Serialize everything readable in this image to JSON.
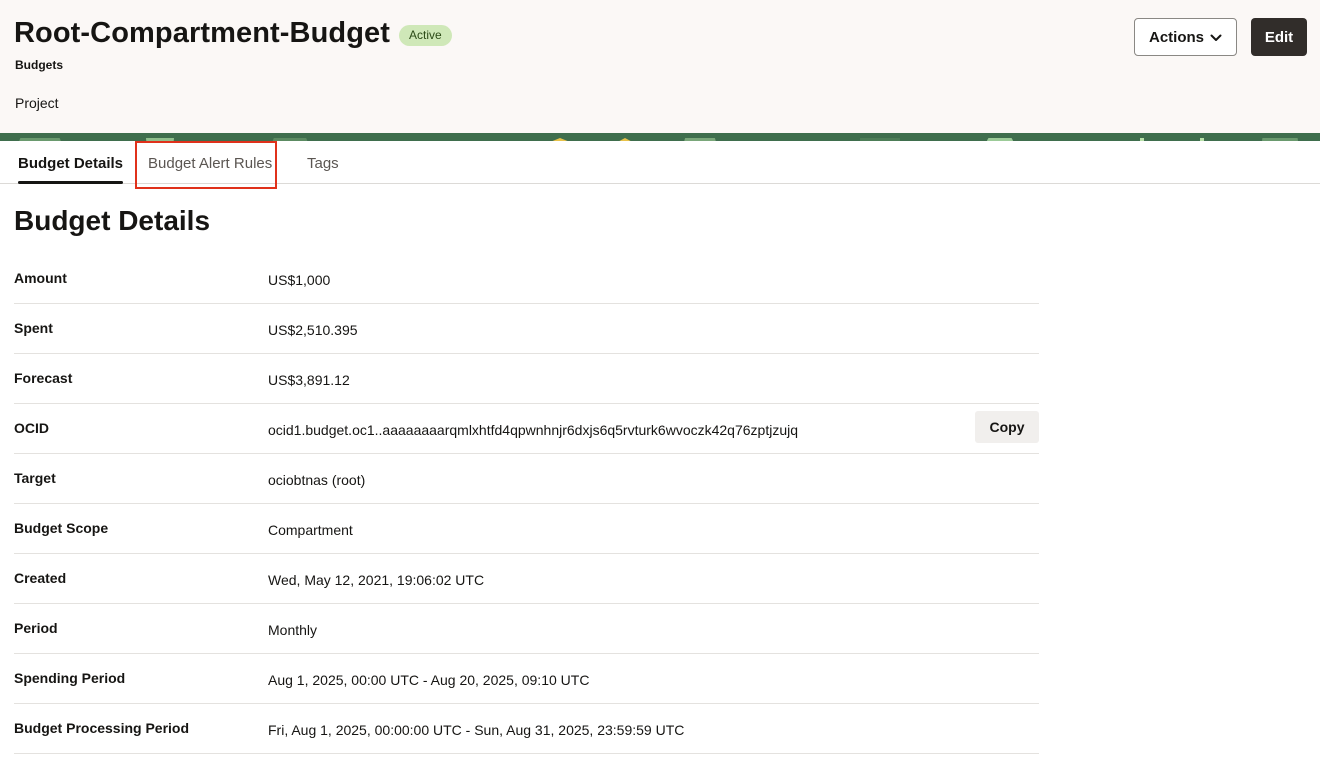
{
  "header": {
    "title": "Root-Compartment-Budget",
    "status_badge": "Active",
    "breadcrumb": "Budgets",
    "project_label": "Project",
    "actions_label": "Actions",
    "edit_label": "Edit"
  },
  "tabs": [
    {
      "label": "Budget Details",
      "active": true
    },
    {
      "label": "Budget Alert Rules",
      "active": false
    },
    {
      "label": "Tags",
      "active": false
    }
  ],
  "section": {
    "title": "Budget Details"
  },
  "details": [
    {
      "label": "Amount",
      "value": "US$1,000"
    },
    {
      "label": "Spent",
      "value": "US$2,510.395"
    },
    {
      "label": "Forecast",
      "value": "US$3,891.12"
    },
    {
      "label": "OCID",
      "value": "ocid1.budget.oc1..aaaaaaaarqmlxhtfd4qpwnhnjr6dxjs6q5rvturk6wvoczk42q76zptjzujq",
      "copy_label": "Copy"
    },
    {
      "label": "Target",
      "value": "ociobtnas (root)"
    },
    {
      "label": "Budget Scope",
      "value": "Compartment"
    },
    {
      "label": "Created",
      "value": "Wed, May 12, 2021, 19:06:02 UTC"
    },
    {
      "label": "Period",
      "value": "Monthly"
    },
    {
      "label": "Spending Period",
      "value": "Aug 1, 2025, 00:00 UTC - Aug 20, 2025, 09:10 UTC"
    },
    {
      "label": "Budget Processing Period",
      "value": "Fri, Aug 1, 2025, 00:00:00 UTC - Sun, Aug 31, 2025, 23:59:59 UTC"
    }
  ],
  "colors": {
    "header_bg": "#fbf8f6",
    "badge_bg": "#cfe8b8",
    "highlight": "#e0311b",
    "edit_bg": "#312d2a"
  },
  "icons": {
    "actions_dropdown": "chevron-down-icon"
  }
}
